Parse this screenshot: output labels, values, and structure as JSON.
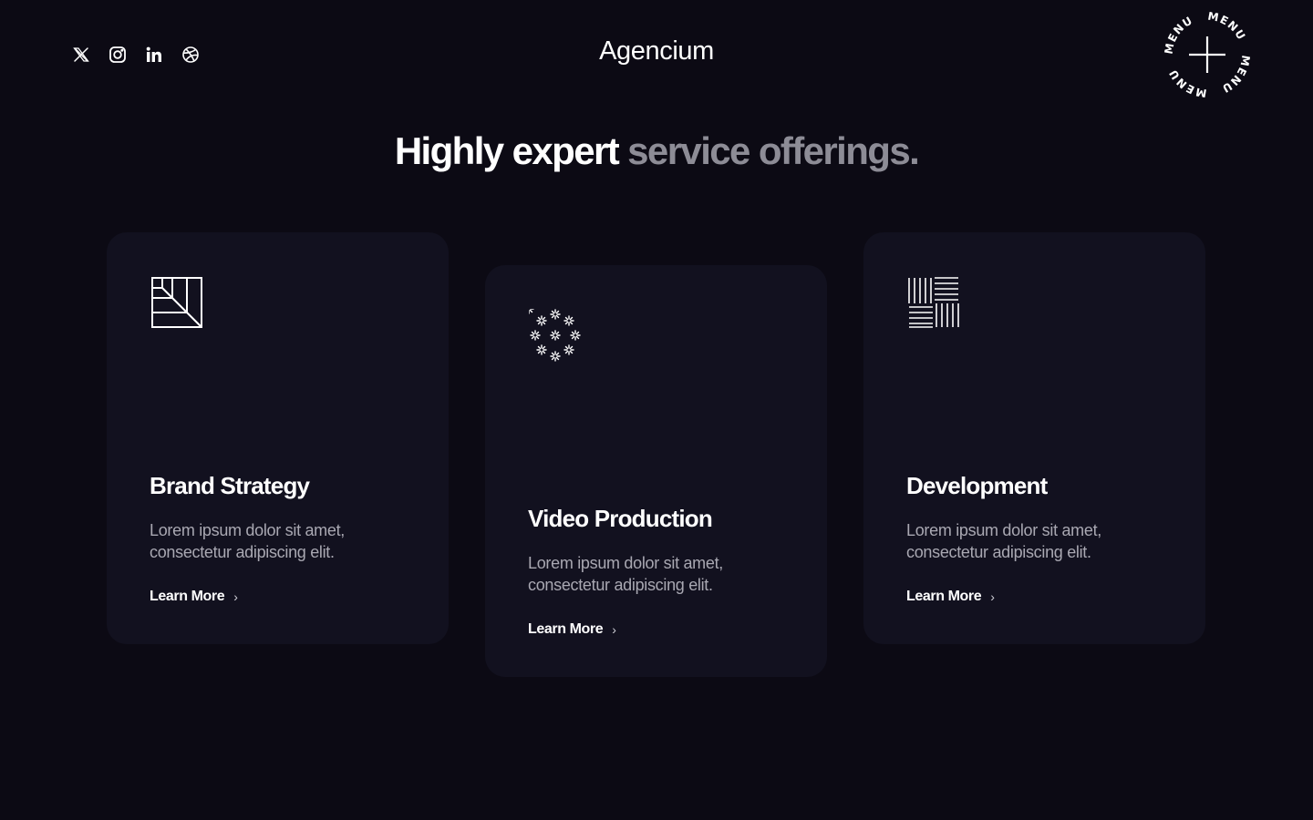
{
  "header": {
    "logo": "Agencium",
    "social": [
      {
        "name": "x-icon"
      },
      {
        "name": "instagram-icon"
      },
      {
        "name": "linkedin-icon"
      },
      {
        "name": "dribbble-icon"
      }
    ],
    "menu_label": "MENU"
  },
  "headline": {
    "strong": "Highly expert",
    "muted": "service offerings."
  },
  "services": [
    {
      "icon": "grid-corner-icon",
      "title": "Brand Strategy",
      "description": "Lorem ipsum dolor sit amet, consectetur adipiscing elit.",
      "link_label": "Learn More"
    },
    {
      "icon": "sparkle-cluster-icon",
      "title": "Video Production",
      "description": "Lorem ipsum dolor sit amet, consectetur adipiscing elit.",
      "link_label": "Learn More"
    },
    {
      "icon": "line-pattern-icon",
      "title": "Development",
      "description": "Lorem ipsum dolor sit amet, consectetur adipiscing elit.",
      "link_label": "Learn More"
    }
  ],
  "colors": {
    "background": "#0c0a14",
    "card": "#12111f",
    "muted_text": "#8d8c96",
    "body_text": "#a9a8b2"
  }
}
